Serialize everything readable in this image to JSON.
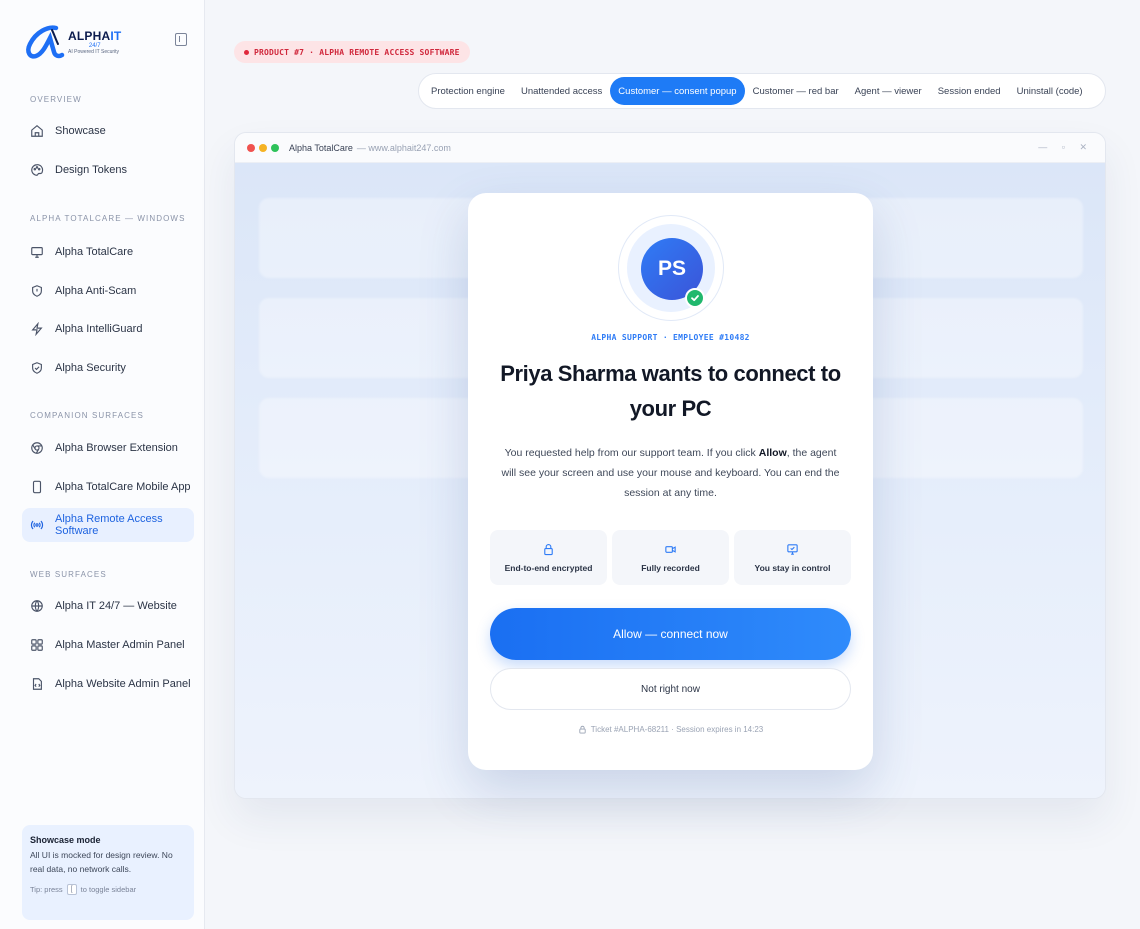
{
  "brand": {
    "name_part1": "ALPHA",
    "name_part2": "IT",
    "tag_247": "24/7",
    "subtitle": "AI Powered IT Security"
  },
  "sidebar": {
    "sections": [
      {
        "label": "OVERVIEW"
      },
      {
        "label": "ALPHA TOTALCARE — WINDOWS"
      },
      {
        "label": "COMPANION SURFACES"
      },
      {
        "label": "WEB SURFACES"
      }
    ],
    "items": [
      {
        "label": "Showcase",
        "icon": "home-icon"
      },
      {
        "label": "Design Tokens",
        "icon": "palette-icon"
      },
      {
        "label": "Alpha TotalCare",
        "icon": "monitor-icon"
      },
      {
        "label": "Alpha Anti-Scam",
        "icon": "shield-alert-icon"
      },
      {
        "label": "Alpha IntelliGuard",
        "icon": "bolt-icon"
      },
      {
        "label": "Alpha Security",
        "icon": "shield-check-icon"
      },
      {
        "label": "Alpha Browser Extension",
        "icon": "browser-extension-icon"
      },
      {
        "label": "Alpha TotalCare Mobile App",
        "icon": "smartphone-icon"
      },
      {
        "label": "Alpha Remote Access Software",
        "icon": "broadcast-icon",
        "active": true
      },
      {
        "label": "Alpha IT 24/7 — Website",
        "icon": "globe-icon"
      },
      {
        "label": "Alpha Master Admin Panel",
        "icon": "grid-icon"
      },
      {
        "label": "Alpha Website Admin Panel",
        "icon": "file-code-icon"
      }
    ],
    "tip": {
      "title": "Showcase mode",
      "body": "All UI is mocked for design review. No real data, no network calls.",
      "hint_prefix": "Tip: press",
      "hint_key": "[",
      "hint_suffix": "to toggle sidebar"
    }
  },
  "product_badge": "PRODUCT #7 · ALPHA REMOTE ACCESS SOFTWARE",
  "tabs": [
    {
      "label": "Protection engine"
    },
    {
      "label": "Unattended access"
    },
    {
      "label": "Customer — consent popup",
      "active": true
    },
    {
      "label": "Customer — red bar"
    },
    {
      "label": "Agent — viewer"
    },
    {
      "label": "Session ended"
    },
    {
      "label": "Uninstall (code)"
    }
  ],
  "window": {
    "title": "Alpha TotalCare",
    "url": "— www.alphait247.com",
    "controls": "— ▫ ✕"
  },
  "dialog": {
    "avatar_initials": "PS",
    "employee": "ALPHA SUPPORT · EMPLOYEE #10482",
    "headline": "Priya Sharma wants to connect to your PC",
    "body_before": "You requested help from our support team. If you click ",
    "body_bold": "Allow",
    "body_after": ", the agent will see your screen and use your mouse and keyboard. You can end the session at any time.",
    "features": [
      {
        "label": "End-to-end encrypted",
        "icon": "lock-icon"
      },
      {
        "label": "Fully recorded",
        "icon": "video-icon"
      },
      {
        "label": "You stay in control",
        "icon": "monitor-check-icon"
      }
    ],
    "allow_label": "Allow — connect now",
    "later_label": "Not right now",
    "ticket": "Ticket #ALPHA-68211 · Session expires in 14:23"
  },
  "colors": {
    "accent": "#1e7bf6",
    "danger": "#e0283c",
    "success": "#20b86d",
    "traffic_red": "#f0524f",
    "traffic_yellow": "#f5b324",
    "traffic_green": "#2ec25a"
  }
}
